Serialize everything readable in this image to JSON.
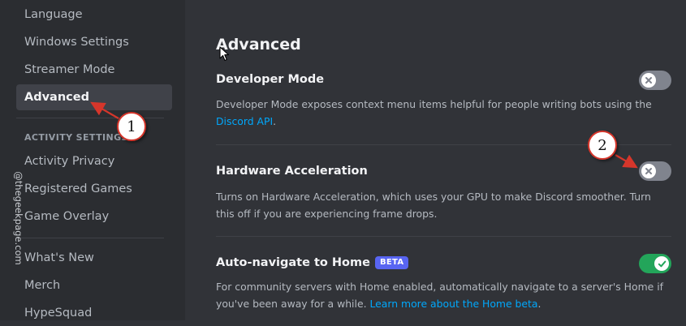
{
  "sidebar": {
    "items_top": [
      {
        "label": "Language"
      },
      {
        "label": "Windows Settings"
      },
      {
        "label": "Streamer Mode"
      },
      {
        "label": "Advanced"
      }
    ],
    "activity_header": "ACTIVITY SETTINGS",
    "activity_items": [
      {
        "label": "Activity Privacy"
      },
      {
        "label": "Registered Games"
      },
      {
        "label": "Game Overlay"
      }
    ],
    "bottom_items": [
      {
        "label": "What's New"
      },
      {
        "label": "Merch"
      },
      {
        "label": "HypeSquad"
      }
    ]
  },
  "watermark": "@thegeekpage.com",
  "main": {
    "title": "Advanced",
    "settings": [
      {
        "title": "Developer Mode",
        "desc": "Developer Mode exposes context menu items helpful for people writing bots using the ",
        "link": "Discord API",
        "desc_end": ".",
        "state": "off"
      },
      {
        "title": "Hardware Acceleration",
        "desc": "Turns on Hardware Acceleration, which uses your GPU to make Discord smoother. Turn this off if you are experiencing frame drops.",
        "state": "off"
      },
      {
        "title": "Auto-navigate to Home",
        "badge": "BETA",
        "desc": "For community servers with Home enabled, automatically navigate to a server's Home if you've been away for a while. ",
        "link": "Learn more about the Home beta",
        "desc_end": ".",
        "state": "on"
      }
    ]
  },
  "annotations": [
    {
      "number": "1"
    },
    {
      "number": "2"
    }
  ],
  "colors": {
    "sidebar_bg": "#2b2d31",
    "content_bg": "#313338",
    "active_item_bg": "#404249",
    "link": "#00a8fc",
    "toggle_off": "#80848e",
    "toggle_on": "#23a55a",
    "beta_badge": "#5865f2",
    "annotation_red": "#d6362b"
  }
}
